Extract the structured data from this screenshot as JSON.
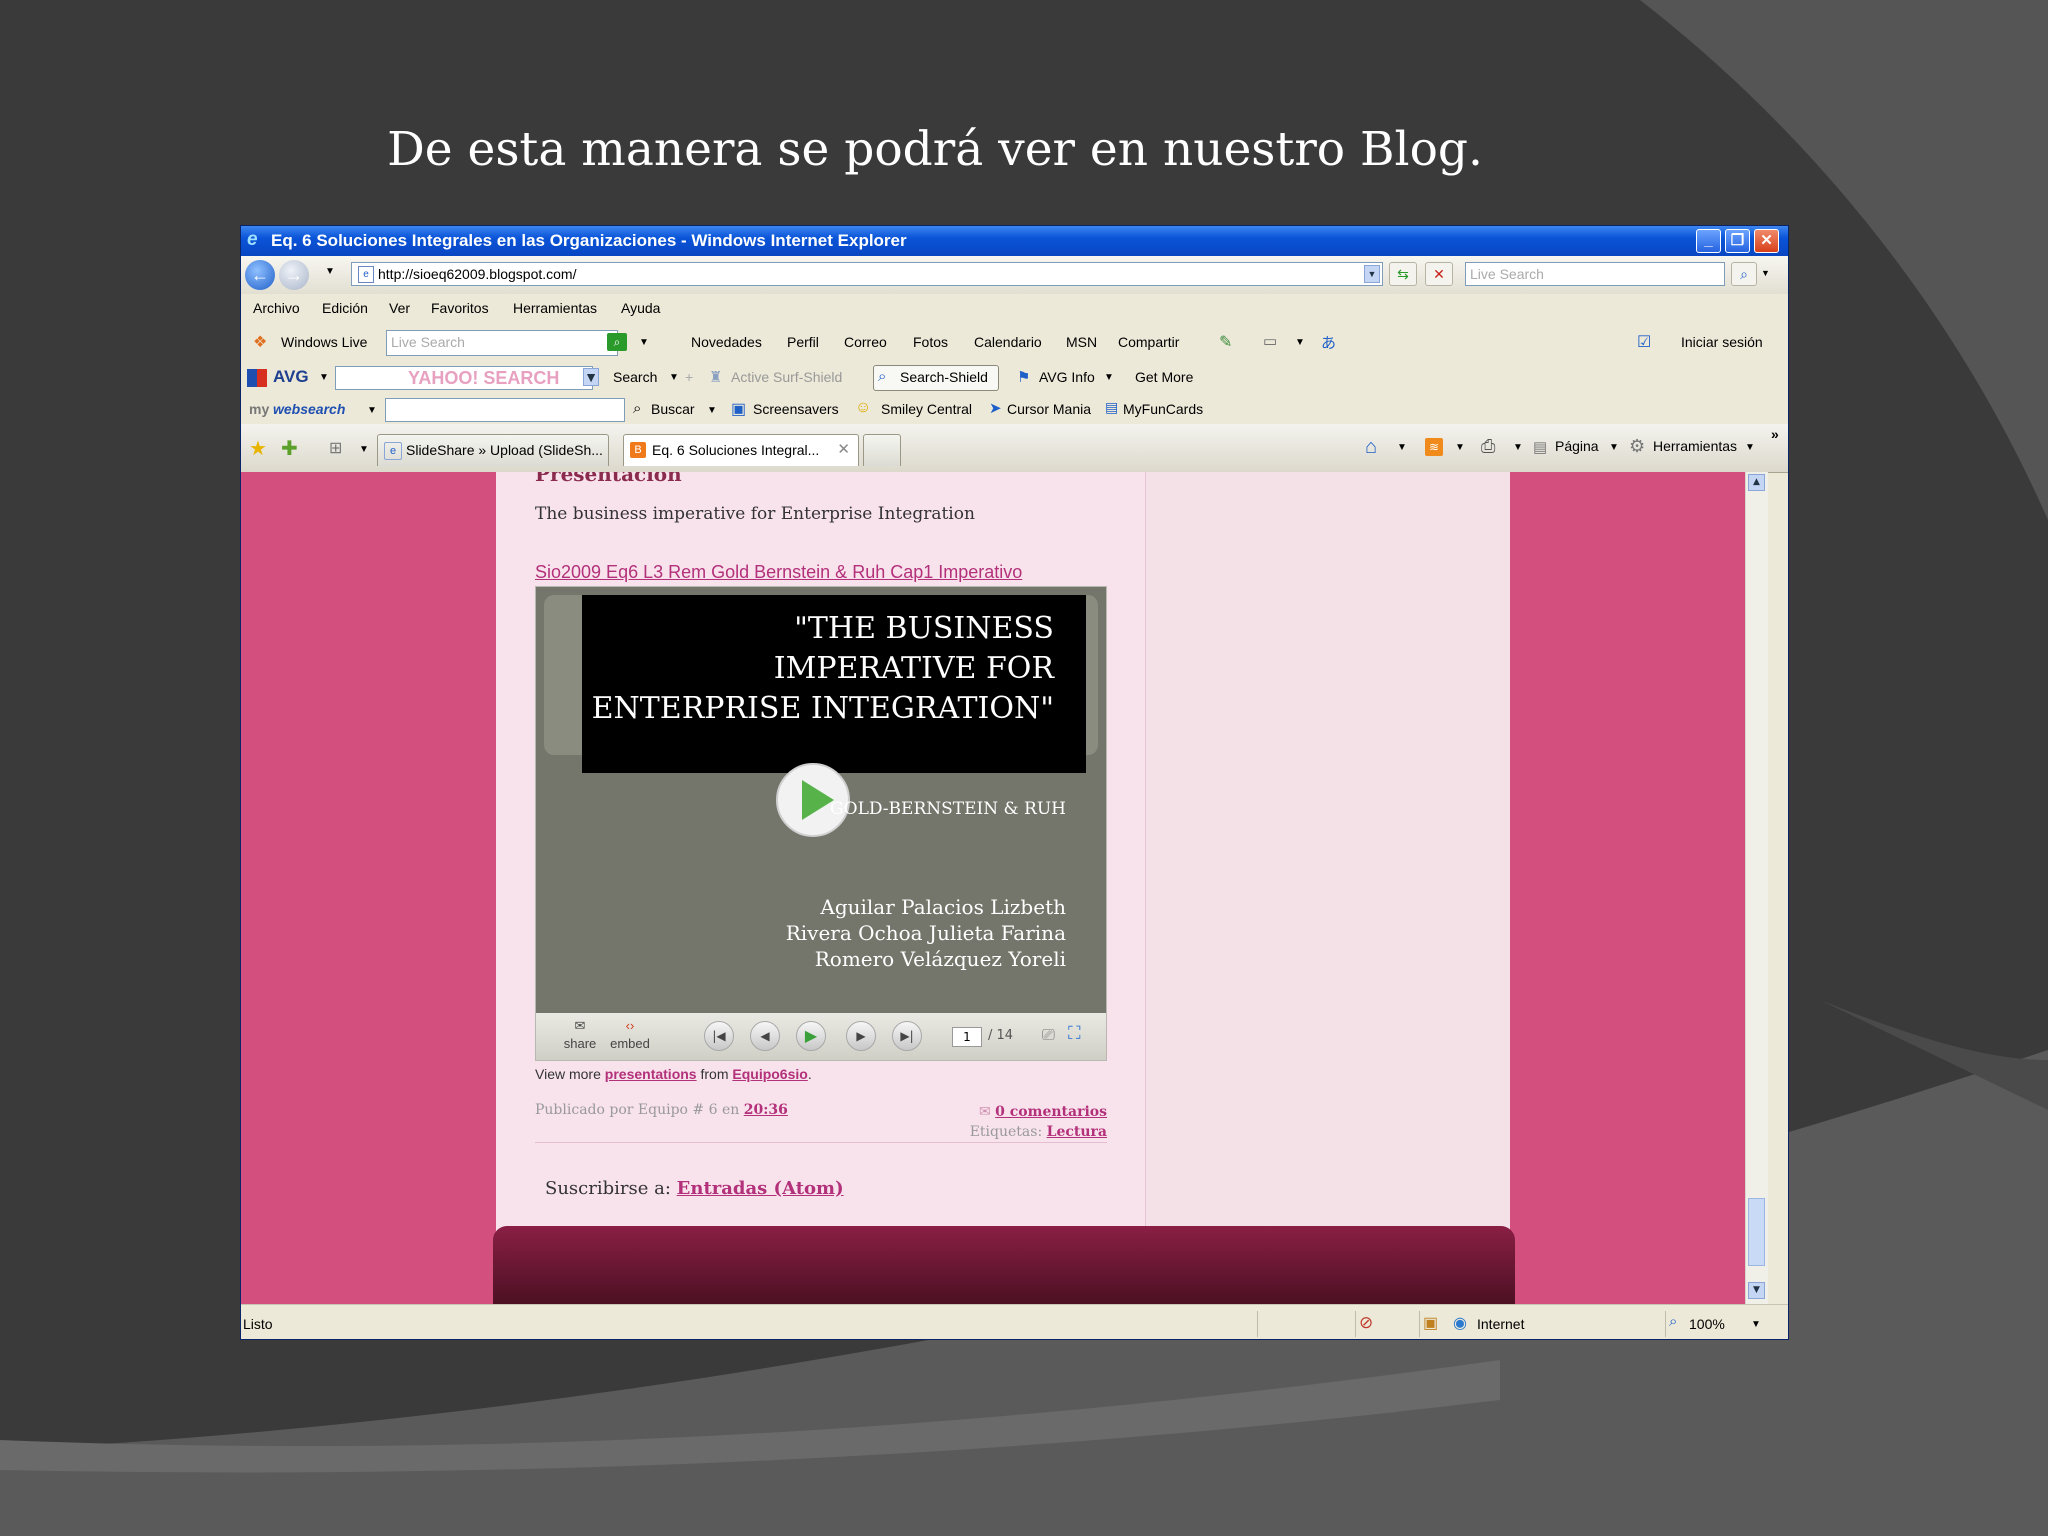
{
  "slide": {
    "title": "De esta manera se podrá ver en nuestro Blog."
  },
  "browser": {
    "window_title": "Eq. 6 Soluciones Integrales en las Organizaciones - Windows Internet Explorer",
    "url": "http://sioeq62009.blogspot.com/",
    "search_placeholder": "Live Search",
    "menu": [
      "Archivo",
      "Edición",
      "Ver",
      "Favoritos",
      "Herramientas",
      "Ayuda"
    ],
    "live_toolbar": {
      "brand": "Windows Live",
      "search_placeholder": "Live Search",
      "links": [
        "Novedades",
        "Perfil",
        "Correo",
        "Fotos",
        "Calendario",
        "MSN",
        "Compartir"
      ],
      "signin": "Iniciar sesión"
    },
    "avg_toolbar": {
      "brand": "AVG",
      "search_brand": "YAHOO! SEARCH",
      "search_label": "Search",
      "active_surf": "Active  Surf-Shield",
      "search_shield": "Search-Shield",
      "avg_info": "AVG Info",
      "get_more": "Get More"
    },
    "mywebsearch_toolbar": {
      "brand_prefix": "my",
      "brand_main": "websearch",
      "buscar": "Buscar",
      "links": [
        "Screensavers",
        "Smiley Central",
        "Cursor Mania",
        "MyFunCards"
      ]
    },
    "tabs": [
      {
        "label": "SlideShare » Upload (SlideSh...",
        "active": false
      },
      {
        "label": "Eq. 6 Soluciones Integral...",
        "active": true
      }
    ],
    "command_bar": {
      "pagina": "Página",
      "herramientas": "Herramientas"
    },
    "status": {
      "text": "Listo",
      "zone": "Internet",
      "zoom": "100%"
    }
  },
  "blog": {
    "post_heading": "Presentación",
    "post_description": "The business imperative for Enterprise Integration",
    "slideshare_link": "Sio2009 Eq6 L3 Rem Gold Bernstein & Ruh Cap1 Imperativo",
    "slide_title": "\"THE BUSINESS IMPERATIVE FOR ENTERPRISE INTEGRATION\"",
    "slide_authors_line": "GOLD-BERNSTEIN & RUH",
    "slide_names": [
      "Aguilar Palacios Lizbeth",
      "Rivera Ochoa Julieta Farina",
      "Romero Velázquez Yoreli"
    ],
    "player": {
      "share_label": "share",
      "embed_label": "embed",
      "current_page": "1",
      "total_pages": "/ 14"
    },
    "view_more": {
      "prefix": "View more",
      "link1": "presentations",
      "middle": "from",
      "link2": "Equipo6sio",
      "suffix": "."
    },
    "meta": {
      "published_by": "Publicado por Equipo # 6",
      "at": "en",
      "time": "20:36",
      "comments": "0 comentarios",
      "labels_prefix": "Etiquetas:",
      "label": "Lectura"
    },
    "subscribe": {
      "prefix": "Suscribirse a:",
      "link": "Entradas (Atom)"
    }
  },
  "colors": {
    "slide_bg": "#3a3a3a",
    "titlebar": "#0a54d8",
    "page_bg": "#d24f7e",
    "post_bg": "#f8e3ec",
    "link": "#b3307a",
    "footer": "#6a1832"
  }
}
